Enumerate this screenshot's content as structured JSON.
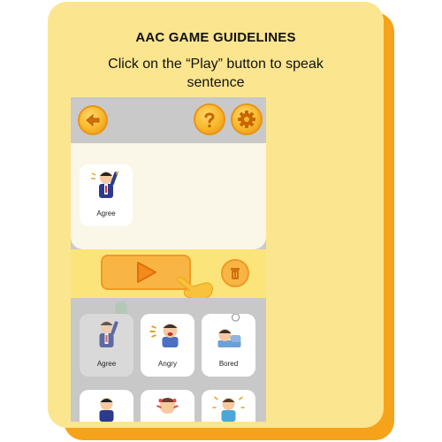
{
  "guide": {
    "heading": "AAC GAME GUIDELINES",
    "instruction": "Click on the “Play” button to speak sentence"
  },
  "app": {
    "toolbar": {
      "back_icon": "arrow-left-icon",
      "help_icon": "question-mark-icon",
      "settings_icon": "gear-icon"
    },
    "sentence": [
      {
        "label": "Agree",
        "icon": "man-raising-hand-illustration"
      }
    ],
    "controls": {
      "play_icon": "play-icon",
      "delete_icon": "trash-can-icon",
      "pointer_icon": "pointing-hand-icon"
    },
    "word_grid": [
      {
        "label": "Agree",
        "icon": "man-raising-hand-illustration",
        "selected": true
      },
      {
        "label": "Angry",
        "icon": "angry-person-illustration",
        "selected": false
      },
      {
        "label": "Bored",
        "icon": "bored-person-illustration",
        "selected": false
      },
      {
        "label": "",
        "icon": "man-in-suit-illustration",
        "selected": false
      },
      {
        "label": "",
        "icon": "upset-person-illustration",
        "selected": false
      },
      {
        "label": "",
        "icon": "excited-man-illustration",
        "selected": false
      }
    ]
  },
  "colors": {
    "card": "#fbe58f",
    "card_shadow": "#f5a31a",
    "button_orange": "#f9b544",
    "play_triangle": "#f28a1c"
  }
}
